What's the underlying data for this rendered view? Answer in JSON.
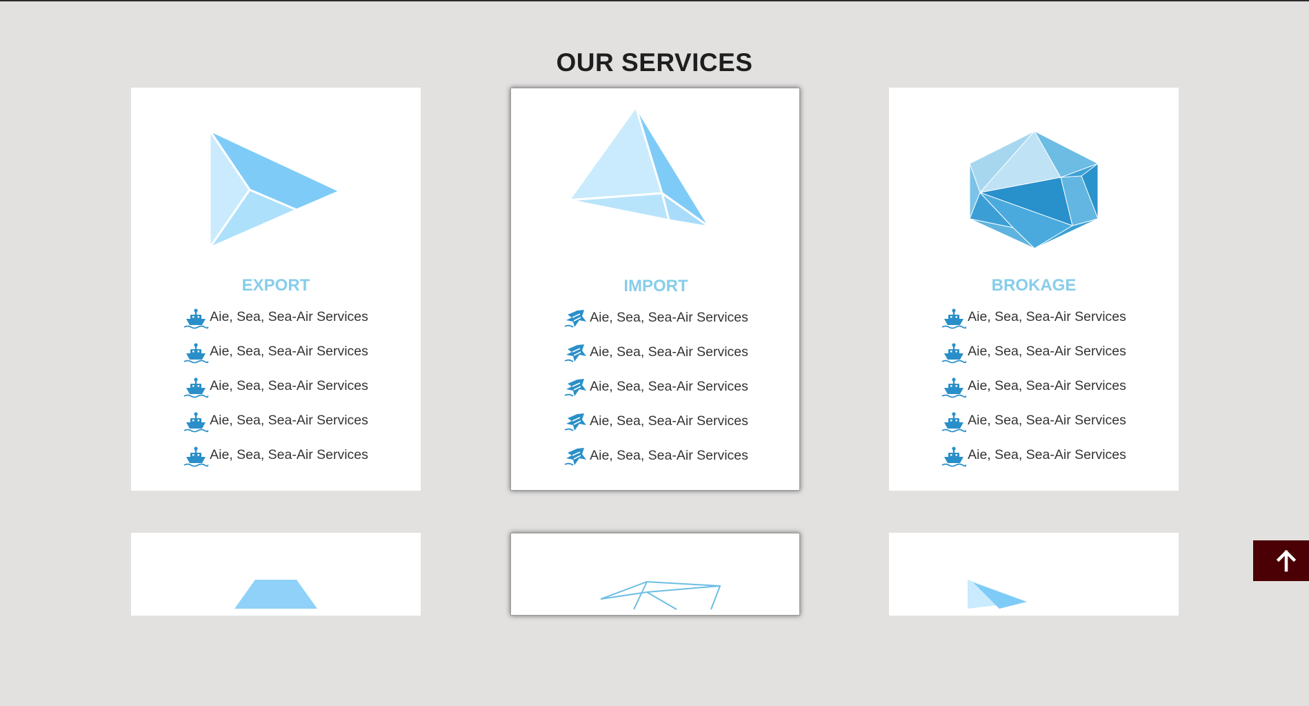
{
  "section": {
    "title": "OUR SERVICES"
  },
  "cards": [
    {
      "title": "EXPORT",
      "icon": "ship-icon",
      "items": [
        "Aie, Sea, Sea-Air Services",
        "Aie, Sea, Sea-Air Services",
        "Aie, Sea, Sea-Air Services",
        "Aie, Sea, Sea-Air Services",
        "Aie, Sea, Sea-Air Services"
      ]
    },
    {
      "title": "IMPORT",
      "icon": "airplane-icon",
      "items": [
        "Aie, Sea, Sea-Air Services",
        "Aie, Sea, Sea-Air Services",
        "Aie, Sea, Sea-Air Services",
        "Aie, Sea, Sea-Air Services",
        "Aie, Sea, Sea-Air Services"
      ]
    },
    {
      "title": "BROKAGE",
      "icon": "ship-icon",
      "items": [
        "Aie, Sea, Sea-Air Services",
        "Aie, Sea, Sea-Air Services",
        "Aie, Sea, Sea-Air Services",
        "Aie, Sea, Sea-Air Services",
        "Aie, Sea, Sea-Air Services"
      ]
    }
  ],
  "colors": {
    "card_title": "#87cdea",
    "icon": "#2a8fc8",
    "back_to_top_bg": "#4a0004",
    "page_bg": "#e2e1e0"
  },
  "back_to_top": {
    "icon": "arrow-up-icon"
  }
}
